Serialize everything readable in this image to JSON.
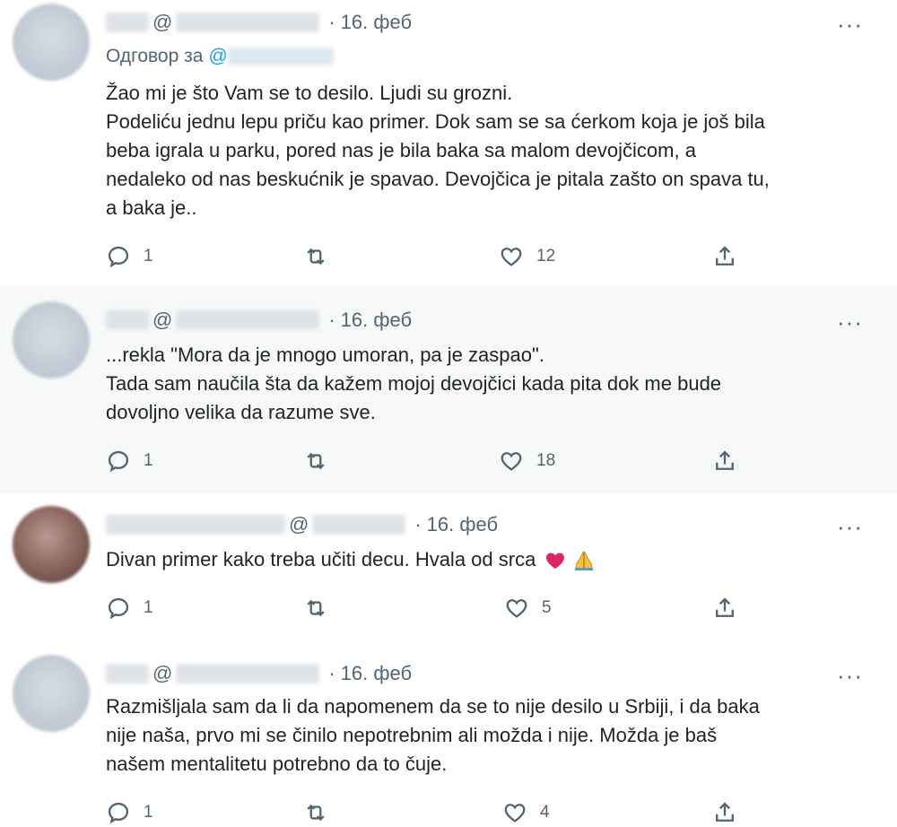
{
  "tweets": [
    {
      "date": "16. феб",
      "reply_label": "Одговор за",
      "mention_at": "@",
      "lines": [
        "Žao mi je što Vam se to desilo. Ljudi su grozni.",
        "Podeliću jednu lepu priču kao primer. Dok sam se sa ćerkom koja je još bila",
        "beba igrala u parku, pored nas je bila baka sa malom devojčicom, a",
        "nedaleko od nas beskućnik je spavao. Devojčica je pitala zašto on spava tu,",
        "a baka je.."
      ],
      "replies": "1",
      "likes": "12"
    },
    {
      "date": "16. феб",
      "lines": [
        "...rekla \"Mora da je mnogo umoran, pa je zaspao\".",
        "Tada sam naučila šta da kažem mojoj devojčici kada pita dok me bude",
        "dovoljno velika da razume sve."
      ],
      "replies": "1",
      "likes": "18"
    },
    {
      "date": "16. феб",
      "lines": [
        "Divan primer kako treba učiti decu. Hvala od srca"
      ],
      "replies": "1",
      "likes": "5"
    },
    {
      "date": "16. феб",
      "lines": [
        "Razmišljala sam da li da napomenem da se to nije desilo u Srbiji, i da baka",
        "nije naša, prvo mi se činilo nepotrebnim ali možda i nije. Možda je baš",
        "našem mentalitetu potrebno da to čuje."
      ],
      "replies": "1",
      "likes": "4"
    }
  ],
  "common": {
    "at": "@",
    "more": "···",
    "dot": "·"
  },
  "icons": {
    "reply": "reply-icon",
    "retweet": "retweet-icon",
    "like": "heart-icon",
    "share": "share-icon",
    "more": "more-icon",
    "emoji_1": "red-heart-emoji",
    "emoji_2": "folded-hands-emoji"
  },
  "colors": {
    "mention": "#1d9bf0",
    "secondary_text": "#536471",
    "heart_emoji": "#e0245e"
  }
}
